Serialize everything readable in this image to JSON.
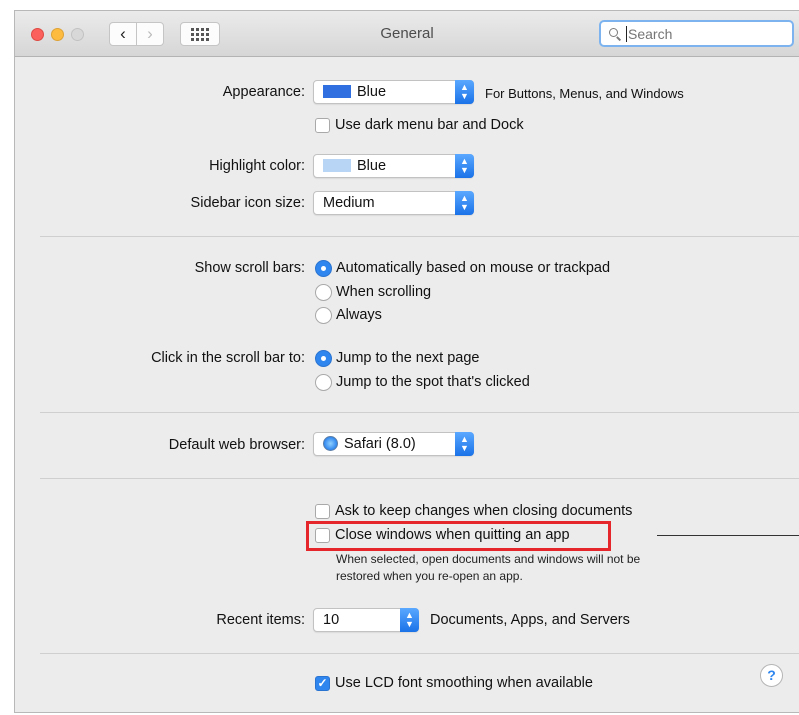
{
  "window": {
    "title": "General",
    "search": {
      "placeholder": "Search"
    }
  },
  "appearance": {
    "label": "Appearance:",
    "value": "Blue",
    "swatch_color": "#2f6fe0",
    "hint": "For Buttons, Menus, and Windows",
    "dark_menu_label": "Use dark menu bar and Dock",
    "dark_menu_checked": false
  },
  "highlight": {
    "label": "Highlight color:",
    "value": "Blue",
    "swatch_color": "#b9d5f6"
  },
  "sidebar": {
    "label": "Sidebar icon size:",
    "value": "Medium"
  },
  "scroll_bars": {
    "label": "Show scroll bars:",
    "options": [
      {
        "label": "Automatically based on mouse or trackpad",
        "selected": true
      },
      {
        "label": "When scrolling",
        "selected": false
      },
      {
        "label": "Always",
        "selected": false
      }
    ]
  },
  "click_scroll": {
    "label": "Click in the scroll bar to:",
    "options": [
      {
        "label": "Jump to the next page",
        "selected": true
      },
      {
        "label": "Jump to the spot that's clicked",
        "selected": false
      }
    ]
  },
  "browser": {
    "label": "Default web browser:",
    "value": "Safari (8.0)"
  },
  "documents": {
    "ask_keep_label": "Ask to keep changes when closing documents",
    "ask_keep_checked": false,
    "close_windows_label": "Close windows when quitting an app",
    "close_windows_checked": false,
    "note_line1": "When selected, open documents and windows will not be",
    "note_line2": "restored when you re-open an app."
  },
  "recent": {
    "label": "Recent items:",
    "value": "10",
    "hint": "Documents, Apps, and Servers"
  },
  "lcd": {
    "label": "Use LCD font smoothing when available",
    "checked": true
  },
  "help": {
    "symbol": "?"
  },
  "colors": {
    "accent": "#2f86ee",
    "highlight_box": "#e5262a"
  }
}
